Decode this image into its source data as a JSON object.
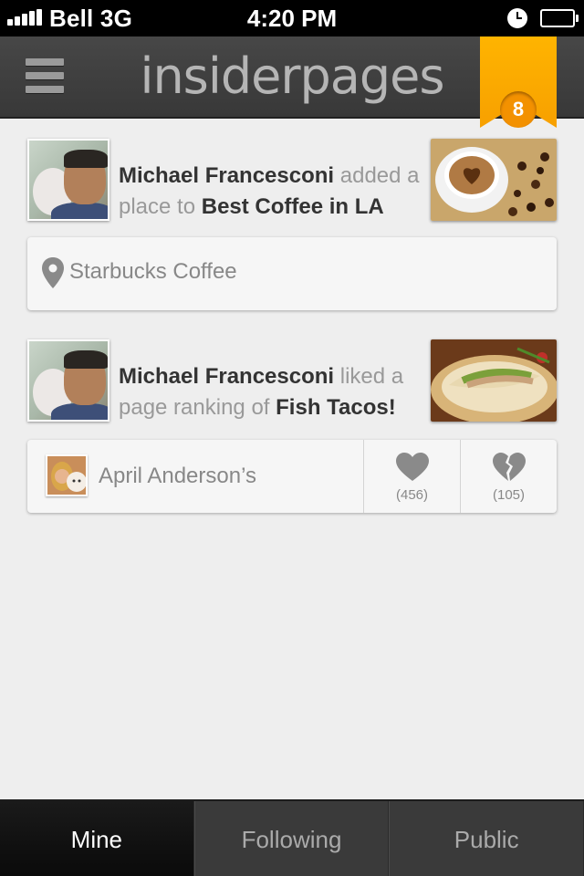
{
  "status_bar": {
    "carrier": "Bell 3G",
    "time": "4:20 PM",
    "signal_bars": 5
  },
  "nav": {
    "logo": "insiderpages",
    "notification_count": "8",
    "accent_color": "#f7a000"
  },
  "feed": [
    {
      "user": "Michael Francesconi",
      "action": "added a place to",
      "target": "Best Coffee in LA",
      "thumb": "coffee-photo",
      "card": {
        "type": "place",
        "icon": "map-pin-icon",
        "name": "Starbucks Coffee"
      }
    },
    {
      "user": "Michael Francesconi",
      "action": "liked a page ranking of",
      "target": "Fish Tacos!",
      "thumb": "fish-tacos-photo",
      "card": {
        "type": "ranking",
        "name": "April Anderson’s",
        "likes": "(456)",
        "dislikes": "(105)"
      }
    }
  ],
  "tabs": [
    {
      "label": "Mine",
      "active": true
    },
    {
      "label": "Following",
      "active": false
    },
    {
      "label": "Public",
      "active": false
    }
  ]
}
